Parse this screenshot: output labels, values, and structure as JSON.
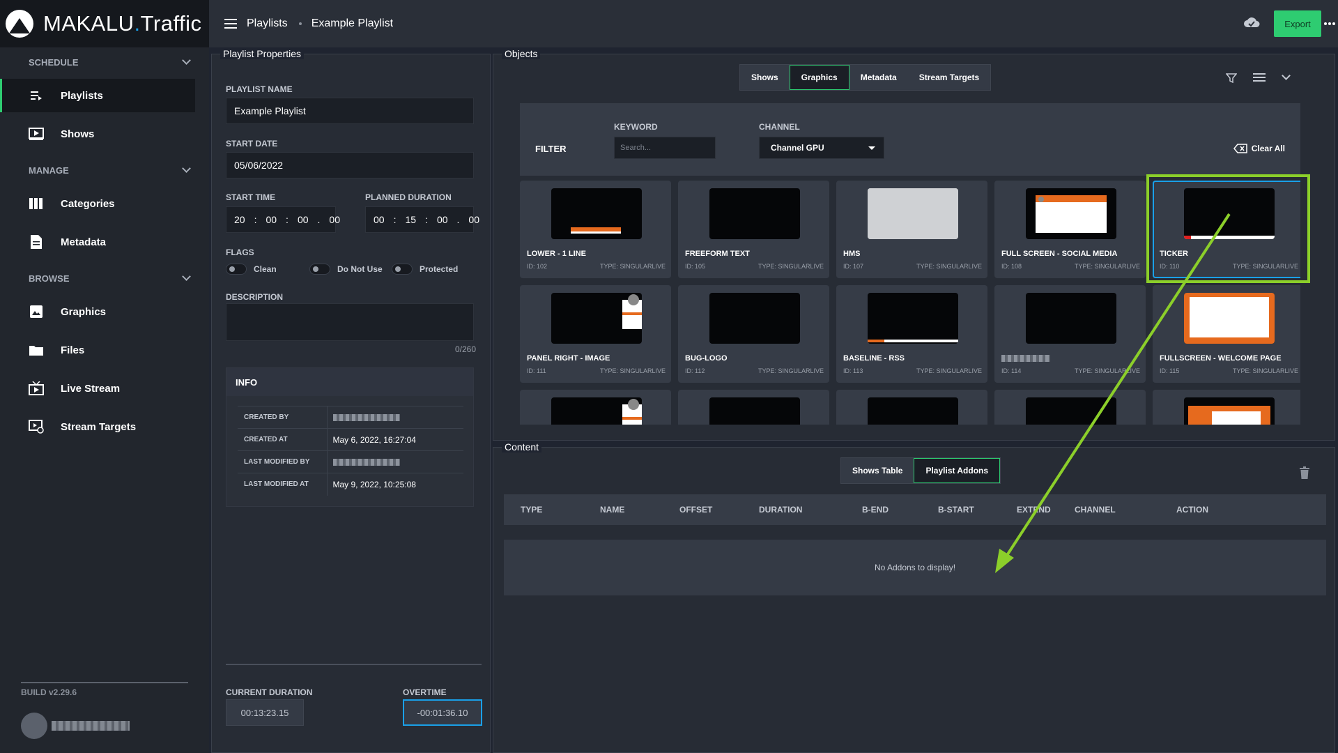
{
  "app": {
    "brand_name": "MAKALU",
    "brand_dot": ".",
    "brand_suffix": "Traffic",
    "build": "BUILD v2.29.6"
  },
  "sidebar": {
    "sections": [
      {
        "label": "SCHEDULE",
        "items": [
          {
            "label": "Playlists",
            "icon": "playlist-icon",
            "active": true
          },
          {
            "label": "Shows",
            "icon": "play-icon"
          }
        ]
      },
      {
        "label": "MANAGE",
        "items": [
          {
            "label": "Categories",
            "icon": "columns-icon"
          },
          {
            "label": "Metadata",
            "icon": "document-icon"
          }
        ]
      },
      {
        "label": "BROWSE",
        "items": [
          {
            "label": "Graphics",
            "icon": "image-icon"
          },
          {
            "label": "Files",
            "icon": "folder-icon"
          },
          {
            "label": "Live Stream",
            "icon": "live-stream-icon"
          },
          {
            "label": "Stream Targets",
            "icon": "stream-target-icon"
          }
        ]
      }
    ]
  },
  "topbar": {
    "breadcrumb": [
      "Playlists",
      "Example Playlist"
    ],
    "export_label": "Export"
  },
  "props": {
    "title": "Playlist Properties",
    "name_label": "PLAYLIST NAME",
    "name_value": "Example Playlist",
    "start_date_label": "START DATE",
    "start_date_value": "05/06/2022",
    "start_time_label": "START TIME",
    "start_time": [
      "20",
      "00",
      "00",
      "00"
    ],
    "planned_duration_label": "PLANNED DURATION",
    "planned_duration": [
      "00",
      "15",
      "00",
      "00"
    ],
    "flags_label": "FLAGS",
    "flags": [
      "Clean",
      "Do Not Use",
      "Protected"
    ],
    "description_label": "DESCRIPTION",
    "description_count": "0/260",
    "info": {
      "title": "INFO",
      "rows": [
        {
          "key": "CREATED BY",
          "value": "",
          "redacted": true
        },
        {
          "key": "CREATED AT",
          "value": "May 6, 2022, 16:27:04"
        },
        {
          "key": "LAST MODIFIED BY",
          "value": "",
          "redacted": true
        },
        {
          "key": "LAST MODIFIED AT",
          "value": "May 9, 2022, 10:25:08"
        }
      ]
    },
    "current_duration_label": "CURRENT DURATION",
    "current_duration_value": "00:13:23.15",
    "overtime_label": "OVERTIME",
    "overtime_value": "-00:01:36.10"
  },
  "objects": {
    "title": "Objects",
    "tabs": [
      "Shows",
      "Graphics",
      "Metadata",
      "Stream Targets"
    ],
    "active_tab": "Graphics",
    "filter_label": "FILTER",
    "keyword_label": "KEYWORD",
    "search_placeholder": "Search...",
    "channel_label": "CHANNEL",
    "channel_value": "Channel GPU",
    "clear_all_label": "Clear All",
    "cards": [
      {
        "title": "LOWER - 1 LINE",
        "id": "ID: 102",
        "type": "TYPE: SINGULARLIVE",
        "thumb": "lower"
      },
      {
        "title": "FREEFORM TEXT",
        "id": "ID: 105",
        "type": "TYPE: SINGULARLIVE",
        "thumb": "black"
      },
      {
        "title": "HMS",
        "id": "ID: 107",
        "type": "TYPE: SINGULARLIVE",
        "thumb": "grey"
      },
      {
        "title": "FULL SCREEN - SOCIAL MEDIA",
        "id": "ID: 108",
        "type": "TYPE: SINGULARLIVE",
        "thumb": "social"
      },
      {
        "title": "TICKER",
        "id": "ID: 110",
        "type": "TYPE: SINGULARLIVE",
        "thumb": "ticker",
        "selected": true
      },
      {
        "title": "PANEL RIGHT - IMAGE",
        "id": "ID: 111",
        "type": "TYPE: SINGULARLIVE",
        "thumb": "panel"
      },
      {
        "title": "BUG-LOGO",
        "id": "ID: 112",
        "type": "TYPE: SINGULARLIVE",
        "thumb": "black"
      },
      {
        "title": "BASELINE - RSS",
        "id": "ID: 113",
        "type": "TYPE: SINGULARLIVE",
        "thumb": "baseline"
      },
      {
        "title": "",
        "id": "ID: 114",
        "type": "TYPE: SINGULARLIVE",
        "thumb": "black",
        "redacted_title": true
      },
      {
        "title": "FULLSCREEN - WELCOME PAGE",
        "id": "ID: 115",
        "type": "TYPE: SINGULARLIVE",
        "thumb": "welcome"
      },
      {
        "title": "",
        "id": "",
        "type": "",
        "thumb": "panel"
      },
      {
        "title": "",
        "id": "",
        "type": "",
        "thumb": "black"
      },
      {
        "title": "",
        "id": "",
        "type": "",
        "thumb": "black"
      },
      {
        "title": "",
        "id": "",
        "type": "",
        "thumb": "black"
      },
      {
        "title": "",
        "id": "",
        "type": "",
        "thumb": "orange"
      }
    ]
  },
  "content": {
    "title": "Content",
    "tabs": [
      "Shows Table",
      "Playlist Addons"
    ],
    "active_tab": "Playlist Addons",
    "columns": [
      "TYPE",
      "NAME",
      "OFFSET",
      "DURATION",
      "B-END",
      "B-START",
      "EXTEND",
      "CHANNEL",
      "ACTION"
    ],
    "empty_message": "No Addons to display!"
  },
  "colors": {
    "accent": "#2ecc71",
    "annotation": "#8ccf2a",
    "selection": "#1aa0e8"
  }
}
